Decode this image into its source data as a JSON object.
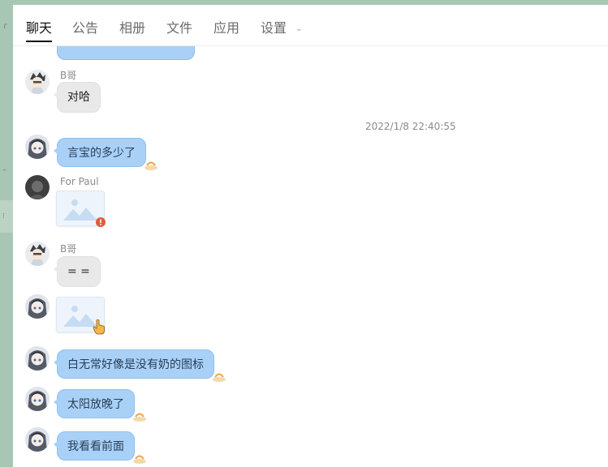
{
  "tabs": [
    {
      "label": "聊天"
    },
    {
      "label": "公告"
    },
    {
      "label": "相册"
    },
    {
      "label": "文件"
    },
    {
      "label": "应用"
    },
    {
      "label": "设置"
    }
  ],
  "messages": [
    {
      "type": "text",
      "sender": "B哥",
      "text": "对哈"
    },
    {
      "type": "timestamp",
      "text": "2022/1/8 22:40:55"
    },
    {
      "type": "text",
      "text": "言宝的多少了"
    },
    {
      "type": "image",
      "sender": "For Paul",
      "status": "load-error"
    },
    {
      "type": "text",
      "sender": "B哥",
      "text": "= ="
    },
    {
      "type": "image",
      "status": "hover"
    },
    {
      "type": "text",
      "text": "白无常好像是没有奶的图标"
    },
    {
      "type": "text",
      "text": "太阳放晚了"
    },
    {
      "type": "text",
      "text": "我看看前面"
    }
  ],
  "colors": {
    "panel_bg": "#ffffff",
    "sidebar_green": "#9dbfa9",
    "bubble_blue": "#a9d1f8",
    "bubble_gray": "#e9e9e9",
    "error_badge": "#e45b3c"
  }
}
